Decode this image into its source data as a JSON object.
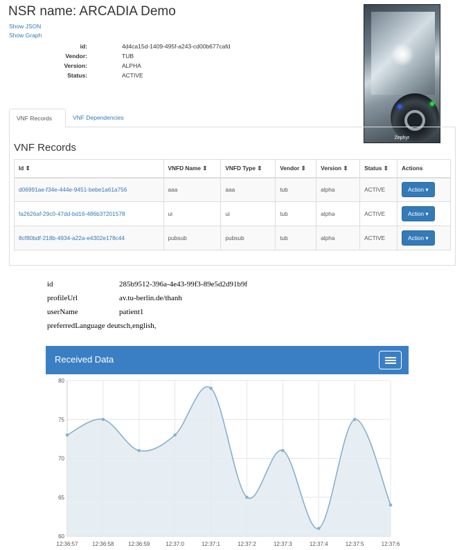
{
  "nsr": {
    "title": "NSR name: ARCADIA Demo",
    "show_json": "Show JSON",
    "show_graph": "Show Graph",
    "fields": [
      {
        "label": "id:",
        "value": "4d4ca15d-1409-495f-a243-cd00b677cafd"
      },
      {
        "label": "Vendor:",
        "value": "TUB"
      },
      {
        "label": "Version:",
        "value": "ALPHA"
      },
      {
        "label": "Status:",
        "value": "ACTIVE"
      }
    ]
  },
  "photo": {
    "caption": "Zephyr"
  },
  "tabs": [
    {
      "label": "VNF Records",
      "active": true
    },
    {
      "label": "VNF Dependencies",
      "active": false
    }
  ],
  "vnf": {
    "heading": "VNF Records",
    "columns": [
      "Id ⇕",
      "VNFD Name ⇕",
      "VNFD Type ⇕",
      "Vendor ⇕",
      "Version ⇕",
      "Status ⇕",
      "Actions"
    ],
    "rows": [
      {
        "id": "d06991ae-f34e-444e-9451-bebe1a61a756",
        "name": "aaa",
        "type": "aaa",
        "vendor": "tub",
        "version": "alpha",
        "status": "ACTIVE",
        "action": "Action ▾"
      },
      {
        "id": "fa2626af-29c0-47dd-bd16-486b37201578",
        "name": "ui",
        "type": "ui",
        "vendor": "tub",
        "version": "alpha",
        "status": "ACTIVE",
        "action": "Action ▾"
      },
      {
        "id": "8cf80bdf-218b-4934-a22a-e4302e178c44",
        "name": "pubsub",
        "type": "pubsub",
        "vendor": "tub",
        "version": "alpha",
        "status": "ACTIVE",
        "action": "Action ▾"
      }
    ]
  },
  "profile": [
    {
      "key": "id",
      "value": "285b9512-396a-4e43-99f3-89e5d2d91b9f"
    },
    {
      "key": "profileUrl",
      "value": "av.tu-berlin.de/thanh"
    },
    {
      "key": "userName",
      "value": "patient1"
    },
    {
      "key": "preferredLanguage",
      "value": "deutsch,english,"
    }
  ],
  "chart_header": {
    "title": "Received Data"
  },
  "colors": {
    "primary": "#337ab7",
    "chart_header": "#3a7fc4",
    "line": "#88b0cc",
    "fill": "#e3ebf1"
  },
  "chart_data": {
    "type": "area",
    "title": "Received Data",
    "x": [
      "12:36:57",
      "12:36:58",
      "12:36:59",
      "12:37:0",
      "12:37:1",
      "12:37:2",
      "12:37:3",
      "12:37:4",
      "12:37:5",
      "12:37:6"
    ],
    "values": [
      73,
      75,
      71,
      73,
      79,
      65,
      71,
      61,
      75,
      64
    ],
    "ylim": [
      60,
      80
    ],
    "yticks": [
      60,
      65,
      70,
      75,
      80
    ],
    "grid": true,
    "smooth": true
  }
}
